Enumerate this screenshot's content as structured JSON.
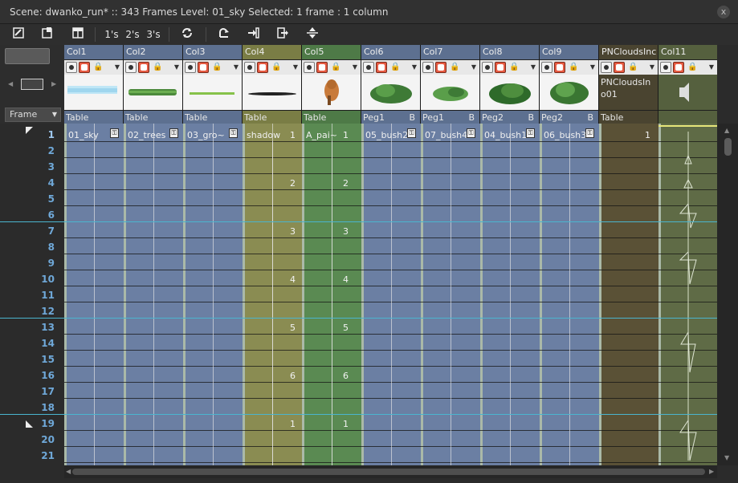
{
  "title_bar": {
    "text": "Scene: dwanko_run*  ::  343 Frames  Level: 01_sky   Selected: 1 frame : 1 column",
    "close_glyph": "x"
  },
  "toolbar": {
    "step1": "1's",
    "step2": "2's",
    "step3": "3's"
  },
  "frame_dropdown": {
    "value": "Frame"
  },
  "columns": [
    {
      "name": "Col1",
      "peg": "Table",
      "cell": "01_sky",
      "color": "#6b7fa3",
      "head": "#5d7090"
    },
    {
      "name": "Col2",
      "peg": "Table",
      "cell": "02_trees",
      "color": "#6b7fa3",
      "head": "#5d7090"
    },
    {
      "name": "Col3",
      "peg": "Table",
      "cell": "03_gro~",
      "color": "#6b7fa3",
      "head": "#5d7090"
    },
    {
      "name": "Col4",
      "peg": "Table",
      "cell": "shadow",
      "color": "#8a8c52",
      "head": "#7a7d45"
    },
    {
      "name": "Col5",
      "peg": "Table",
      "cell": "A_pai~",
      "color": "#5a8a52",
      "head": "#4e7a47"
    },
    {
      "name": "Col6",
      "peg": "Peg1",
      "cell": "05_bush2",
      "color": "#6b7fa3",
      "head": "#5d7090",
      "b": "B"
    },
    {
      "name": "Col7",
      "peg": "Peg1",
      "cell": "07_bush4",
      "color": "#6b7fa3",
      "head": "#5d7090",
      "b": "B"
    },
    {
      "name": "Col8",
      "peg": "Peg2",
      "cell": "04_bush1",
      "color": "#6b7fa3",
      "head": "#5d7090",
      "b": "B"
    },
    {
      "name": "Col9",
      "peg": "Peg2",
      "cell": "06_bush3",
      "color": "#6b7fa3",
      "head": "#5d7090",
      "b": "B"
    },
    {
      "name": "PNCloudsInc",
      "peg": "Table",
      "cell": "",
      "color": "#5a5136",
      "head": "#4a4430",
      "thumb_text": "PNCloudsIn o01"
    },
    {
      "name": "Col11",
      "peg": "",
      "cell": "",
      "color": "#5f6b46",
      "head": "#55603e"
    }
  ],
  "frames": [
    "1",
    "2",
    "3",
    "4",
    "5",
    "6",
    "7",
    "8",
    "9",
    "10",
    "11",
    "12",
    "13",
    "14",
    "15",
    "16",
    "17",
    "18",
    "19",
    "20",
    "21"
  ],
  "shadow_numbers": [
    "1",
    "2",
    "3",
    "4",
    "5",
    "6",
    "1"
  ],
  "apai_numbers": [
    "1",
    "2",
    "3",
    "4",
    "5",
    "6",
    "1"
  ],
  "pn_number": "1"
}
